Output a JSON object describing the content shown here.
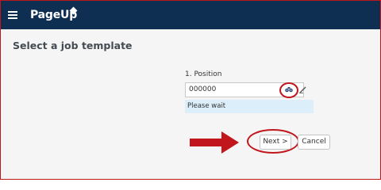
{
  "header": {
    "logo_text": "PageUp",
    "menu_icon": "hamburger-menu-icon",
    "logo_icon": "diamond-logo-icon",
    "background_color": "#0e2f52"
  },
  "page": {
    "title": "Select a job template"
  },
  "form": {
    "position_label": "1. Position",
    "position_value": "000000",
    "lookup_icon": "binoculars-icon",
    "edit_icon": "pencil-icon",
    "status_text": "Please wait",
    "status_color": "#dbeefa"
  },
  "actions": {
    "next_label": "Next >",
    "cancel_label": "Cancel"
  },
  "annotations": {
    "highlight_color": "#c0161c",
    "arrow_icon": "right-arrow-icon"
  }
}
